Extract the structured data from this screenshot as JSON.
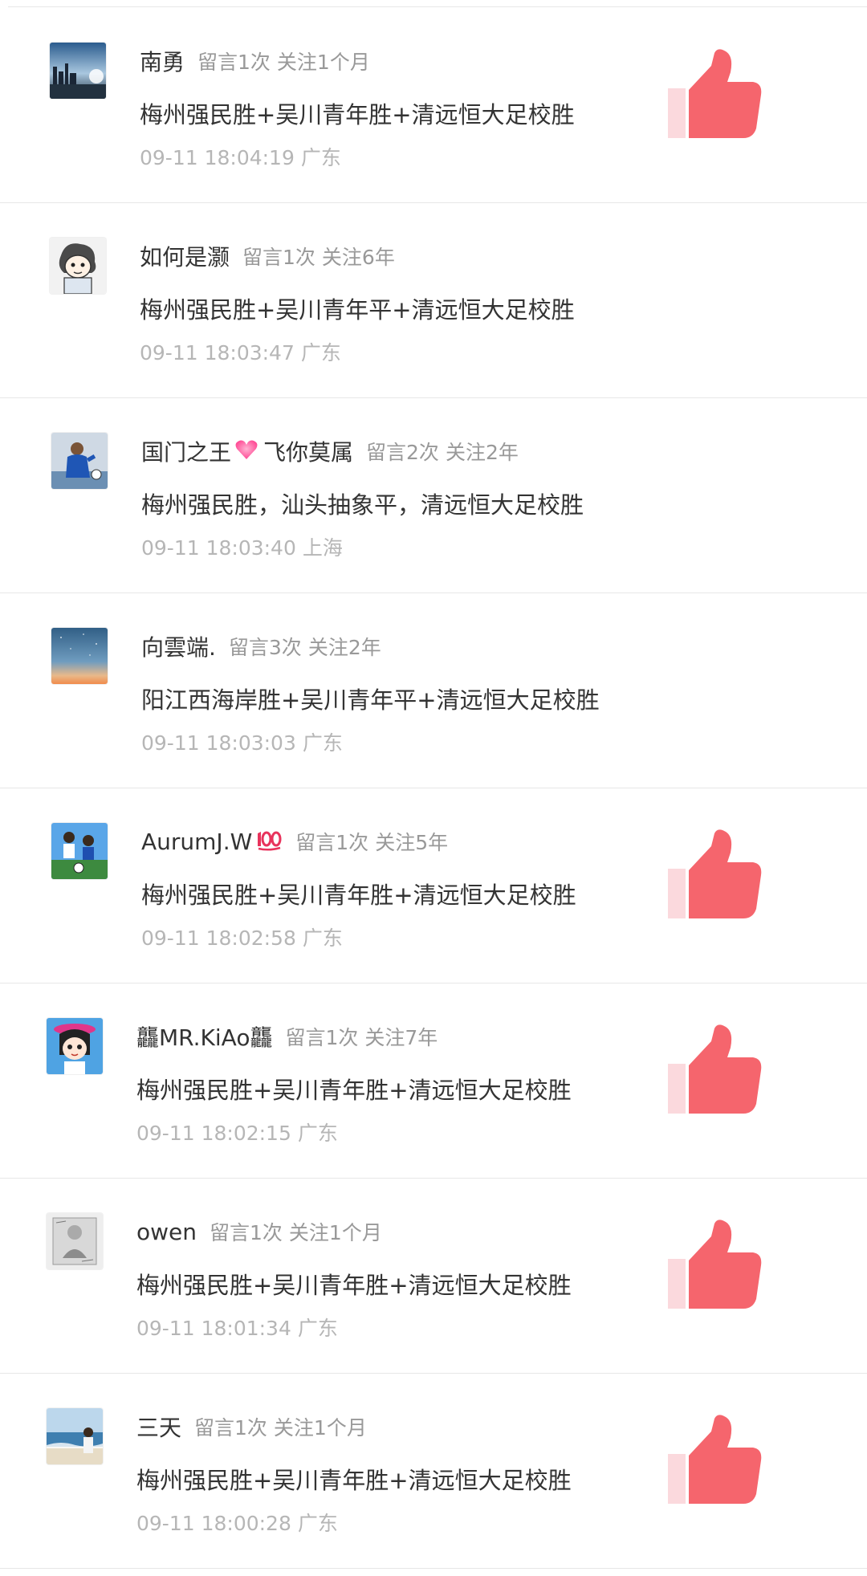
{
  "colors": {
    "like_accent": "#f5656d",
    "like_pale": "#fbd9dd",
    "name_text": "#333333",
    "stats_text": "#999999",
    "meta_text": "#b6b6b6",
    "divider": "#e7e7e7"
  },
  "comments": [
    {
      "nickname": "南勇",
      "visits": "留言1次",
      "follow": "关注1个月",
      "content": "梅州强民胜+吴川青年胜+清远恒大足校胜",
      "time": "09-11 18:04:19",
      "location": "广东",
      "liked": true,
      "avatar_icon": "city-skyline-avatar-icon"
    },
    {
      "nickname": "如何是灏",
      "visits": "留言1次",
      "follow": "关注6年",
      "content": "梅州强民胜+吴川青年平+清远恒大足校胜",
      "time": "09-11 18:03:47",
      "location": "广东",
      "liked": false,
      "avatar_icon": "cartoon-character-avatar-icon"
    },
    {
      "nickname": "国门之王",
      "name_suffix": "飞你莫属",
      "visits": "留言2次",
      "follow": "关注2年",
      "content": "梅州强民胜，汕头抽象平，清远恒大足校胜",
      "time": "09-11 18:03:40",
      "location": "上海",
      "liked": false,
      "avatar_icon": "goalkeeper-photo-avatar-icon",
      "emoji_icon": "pink-heart-icon"
    },
    {
      "nickname": "向雲端.",
      "visits": "留言3次",
      "follow": "关注2年",
      "content": "阳江西海岸胜+吴川青年平+清远恒大足校胜",
      "time": "09-11 18:03:03",
      "location": "广东",
      "liked": false,
      "avatar_icon": "starry-sky-avatar-icon"
    },
    {
      "nickname": "AurumJ.W",
      "visits": "留言1次",
      "follow": "关注5年",
      "content": "梅州强民胜+吴川青年胜+清远恒大足校胜",
      "time": "09-11 18:02:58",
      "location": "广东",
      "liked": true,
      "avatar_icon": "soccer-cartoon-avatar-icon",
      "emoji_icon": "hundred-points-icon"
    },
    {
      "nickname": "龘MR.KiAo龘",
      "visits": "留言1次",
      "follow": "关注7年",
      "content": "梅州强民胜+吴川青年胜+清远恒大足校胜",
      "time": "09-11 18:02:15",
      "location": "广东",
      "liked": true,
      "avatar_icon": "anime-girl-avatar-icon"
    },
    {
      "nickname": "owen",
      "visits": "留言1次",
      "follow": "关注1个月",
      "content": "梅州强民胜+吴川青年胜+清远恒大足校胜",
      "time": "09-11 18:01:34",
      "location": "广东",
      "liked": true,
      "avatar_icon": "sketch-portrait-avatar-icon"
    },
    {
      "nickname": "三天",
      "visits": "留言1次",
      "follow": "关注1个月",
      "content": "梅州强民胜+吴川青年胜+清远恒大足校胜",
      "time": "09-11 18:00:28",
      "location": "广东",
      "liked": true,
      "avatar_icon": "beach-photo-avatar-icon"
    }
  ]
}
